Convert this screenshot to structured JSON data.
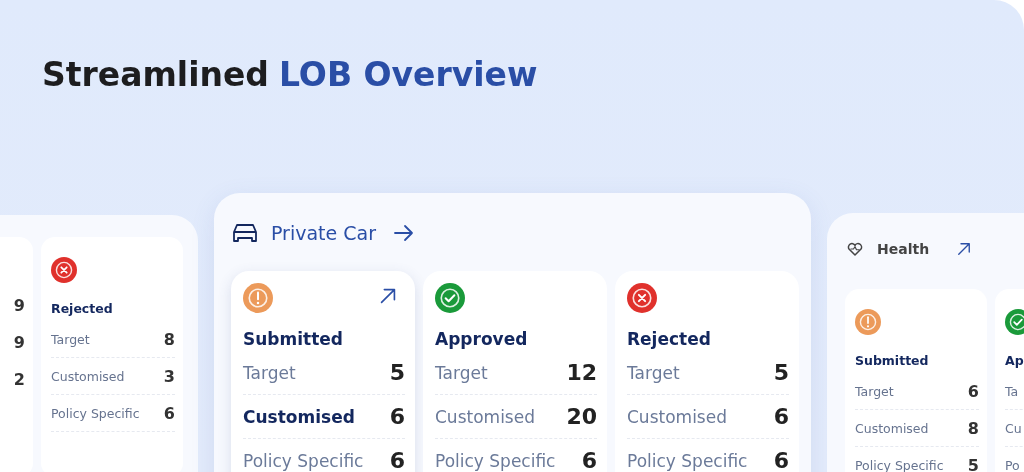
{
  "title": {
    "text": "Streamlined",
    "highlight": "LOB Overview"
  },
  "panels": [
    {
      "kind": "side",
      "cards": [
        {
          "selected": false,
          "rows": [
            {
              "value": "9"
            },
            {
              "value": "9"
            },
            {
              "value": "2"
            }
          ]
        },
        {
          "kind": "rejected",
          "title": "Rejected",
          "selected": false,
          "rows": [
            {
              "label": "Target",
              "value": "8",
              "selected": false
            },
            {
              "label": "Customised",
              "value": "3",
              "selected": false
            },
            {
              "label": "Policy Specific",
              "value": "6",
              "selected": false
            }
          ]
        }
      ]
    },
    {
      "kind": "main",
      "header": {
        "label": "Private Car"
      },
      "cards": [
        {
          "kind": "submitted",
          "title": "Submitted",
          "selected": true,
          "rows": [
            {
              "label": "Target",
              "value": "5",
              "selected": false
            },
            {
              "label": "Customised",
              "value": "6",
              "selected": true
            },
            {
              "label": "Policy Specific",
              "value": "6",
              "selected": false
            }
          ]
        },
        {
          "kind": "approved",
          "title": "Approved",
          "selected": false,
          "rows": [
            {
              "label": "Target",
              "value": "12",
              "selected": false
            },
            {
              "label": "Customised",
              "value": "20",
              "selected": false
            },
            {
              "label": "Policy Specific",
              "value": "6",
              "selected": false
            }
          ]
        },
        {
          "kind": "rejected",
          "title": "Rejected",
          "selected": false,
          "rows": [
            {
              "label": "Target",
              "value": "5",
              "selected": false
            },
            {
              "label": "Customised",
              "value": "6",
              "selected": false
            },
            {
              "label": "Policy Specific",
              "value": "6",
              "selected": false
            }
          ]
        }
      ]
    },
    {
      "kind": "side",
      "header": {
        "label": "Health"
      },
      "cards": [
        {
          "kind": "submitted",
          "title": "Submitted",
          "selected": false,
          "rows": [
            {
              "label": "Target",
              "value": "6",
              "selected": false
            },
            {
              "label": "Customised",
              "value": "8",
              "selected": false
            },
            {
              "label": "Policy Specific",
              "value": "5",
              "selected": false
            }
          ]
        },
        {
          "kind": "approved",
          "title": "Ap",
          "selected": false,
          "rows": [
            {
              "label": "Ta",
              "selected": false
            },
            {
              "label": "Cu",
              "selected": false
            },
            {
              "label": "Po",
              "selected": false
            }
          ]
        }
      ]
    }
  ]
}
